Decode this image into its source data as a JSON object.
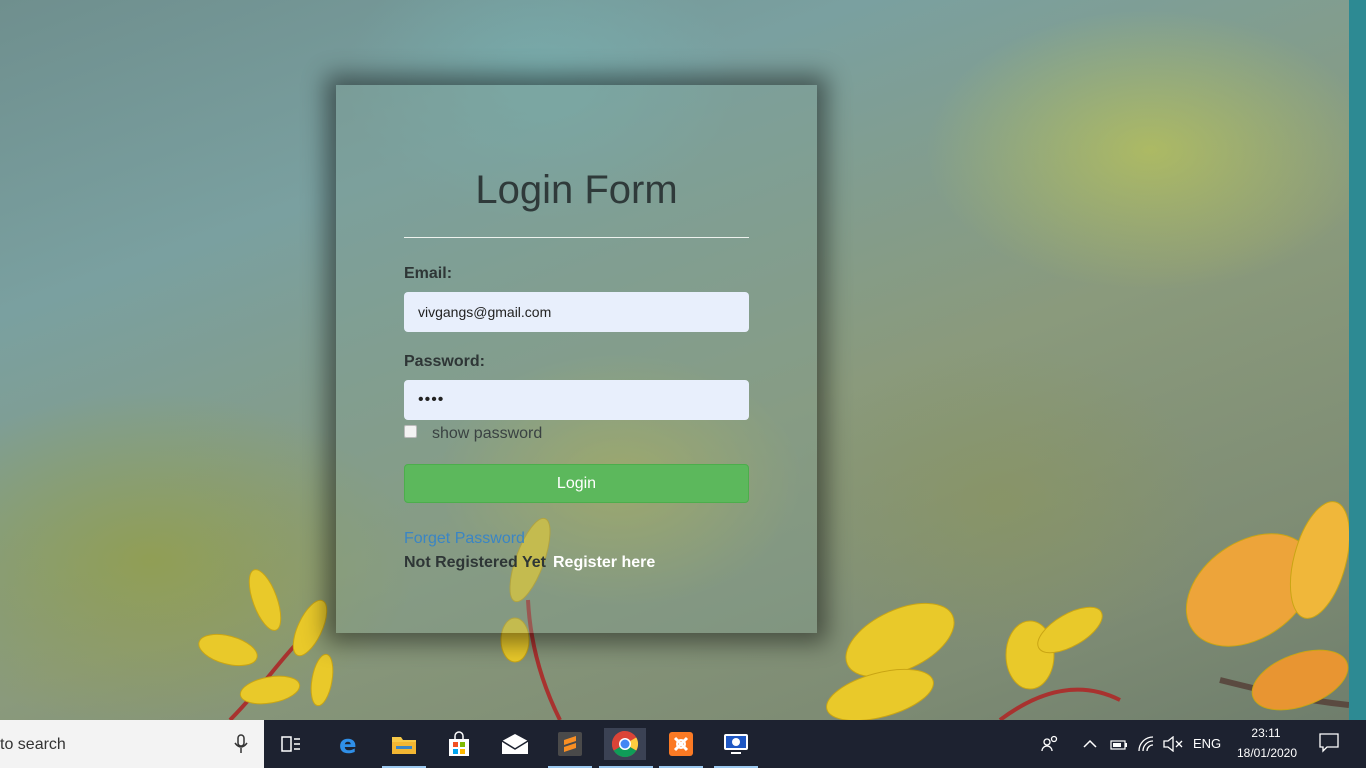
{
  "form": {
    "title": "Login Form",
    "email_label": "Email:",
    "email_value": "vivgangs@gmail.com",
    "password_label": "Password:",
    "password_value": "••••",
    "show_password_label": "show password",
    "login_button": "Login",
    "forget_password": "Forget Password",
    "not_registered": "Not Registered Yet",
    "register_link": "Register here"
  },
  "taskbar": {
    "search_text": "to search",
    "apps": [
      "task-view",
      "edge",
      "file-explorer",
      "microsoft-store",
      "mail",
      "sublime-text",
      "chrome",
      "xampp",
      "remote-desktop"
    ],
    "language": "ENG",
    "time": "23:11",
    "date": "18/01/2020"
  },
  "colors": {
    "login_button": "#5cb85c",
    "link": "#3a85c4",
    "taskbar": "#1d2230"
  }
}
